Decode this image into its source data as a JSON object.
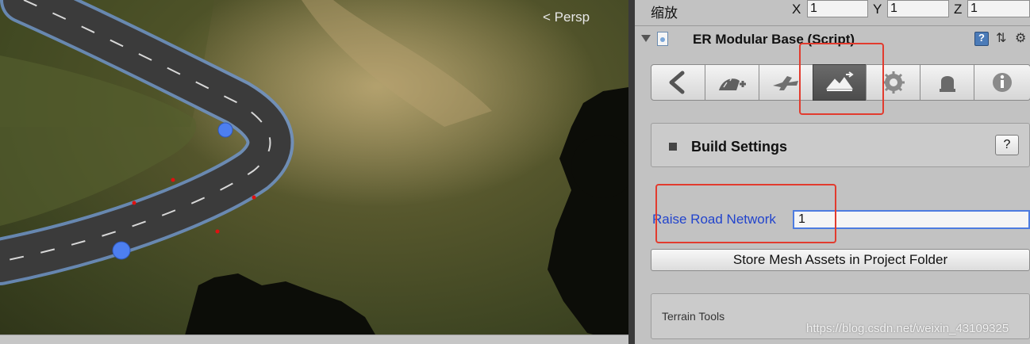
{
  "scene": {
    "view_label": "Persp",
    "view_label_icon": "perspective-chevron-icon"
  },
  "transform": {
    "scale_label": "缩放",
    "x_label": "X",
    "x_value": "1",
    "y_label": "Y",
    "y_value": "1",
    "z_label": "Z",
    "z_value": "1"
  },
  "component": {
    "title": "ER Modular Base (Script)",
    "icons": [
      "foldout-arrow-icon",
      "script-icon",
      "help-book-icon",
      "preset-icon",
      "gear-icon"
    ]
  },
  "toolbar": {
    "tabs": [
      {
        "name": "back-tab",
        "icon": "back-arrow-icon"
      },
      {
        "name": "add-road-tab",
        "icon": "road-add-icon"
      },
      {
        "name": "connection-tab",
        "icon": "connection-icon"
      },
      {
        "name": "build-terrain-tab",
        "icon": "terrain-build-icon",
        "active": true
      },
      {
        "name": "settings-tab",
        "icon": "gear-icon"
      },
      {
        "name": "tools-tab",
        "icon": "tools-icon"
      },
      {
        "name": "info-tab",
        "icon": "info-icon"
      }
    ]
  },
  "build_settings": {
    "title": "Build Settings",
    "help_label": "?"
  },
  "raise_road": {
    "label": "Raise Road Network",
    "value": "1"
  },
  "store_button": {
    "label": "Store Mesh Assets in Project Folder"
  },
  "terrain_tools": {
    "title": "Terrain Tools"
  },
  "watermark": {
    "text": "https://blog.csdn.net/weixin_43109325"
  },
  "colors": {
    "highlight": "#e23b2e",
    "link_blue": "#2244cc",
    "inspector_bg": "#c2c2c2"
  }
}
